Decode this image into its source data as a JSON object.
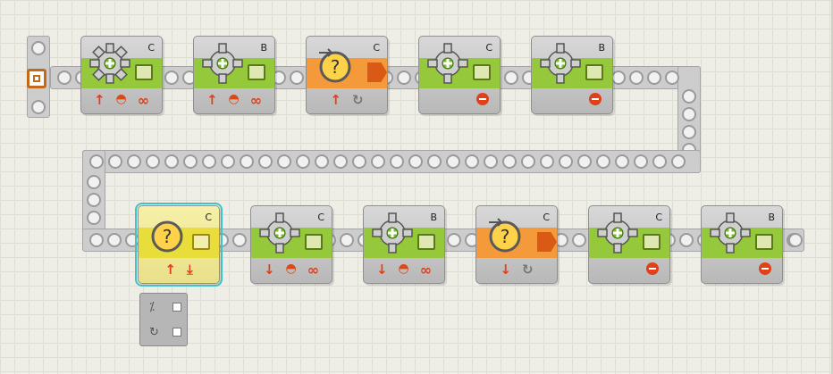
{
  "canvas": {
    "background": "#eeeee6",
    "grid": true
  },
  "program": {
    "start_icon": "start-block-icon",
    "row1_blocks": [
      {
        "type": "motor",
        "port": "C",
        "band_color": "#95c83a",
        "direction": "up-arrow",
        "power_icon": "power-gauge-icon",
        "duration": "unlimited-infinity-icon"
      },
      {
        "type": "motor",
        "port": "B",
        "band_color": "#95c83a",
        "direction": "up-arrow",
        "power_icon": "power-gauge-icon",
        "duration": "unlimited-infinity-icon"
      },
      {
        "type": "rotation-sensor",
        "port": "C",
        "band_color": "#f59a3a",
        "direction": "up-arrow",
        "extra_icon": "rotation-icon"
      },
      {
        "type": "motor",
        "port": "C",
        "band_color": "#95c83a",
        "action": "stop-icon"
      },
      {
        "type": "motor",
        "port": "B",
        "band_color": "#95c83a",
        "action": "stop-icon"
      }
    ],
    "row2_blocks": [
      {
        "type": "rotation-sensor",
        "port": "C",
        "band_color": "#e8dd3a",
        "direction": "up-arrow",
        "extra_icon": "download-icon",
        "selected": true
      },
      {
        "type": "motor",
        "port": "C",
        "band_color": "#95c83a",
        "direction": "down-arrow",
        "power_icon": "power-gauge-icon",
        "duration": "unlimited-infinity-icon"
      },
      {
        "type": "motor",
        "port": "B",
        "band_color": "#95c83a",
        "direction": "down-arrow",
        "power_icon": "power-gauge-icon",
        "duration": "unlimited-infinity-icon"
      },
      {
        "type": "rotation-sensor",
        "port": "C",
        "band_color": "#f59a3a",
        "direction": "down-arrow",
        "extra_icon": "rotation-icon"
      },
      {
        "type": "motor",
        "port": "C",
        "band_color": "#95c83a",
        "action": "stop-icon"
      },
      {
        "type": "motor",
        "port": "B",
        "band_color": "#95c83a",
        "action": "stop-icon"
      }
    ],
    "data_hub": {
      "items": [
        "compare-icon",
        "rotation-icon"
      ]
    }
  }
}
